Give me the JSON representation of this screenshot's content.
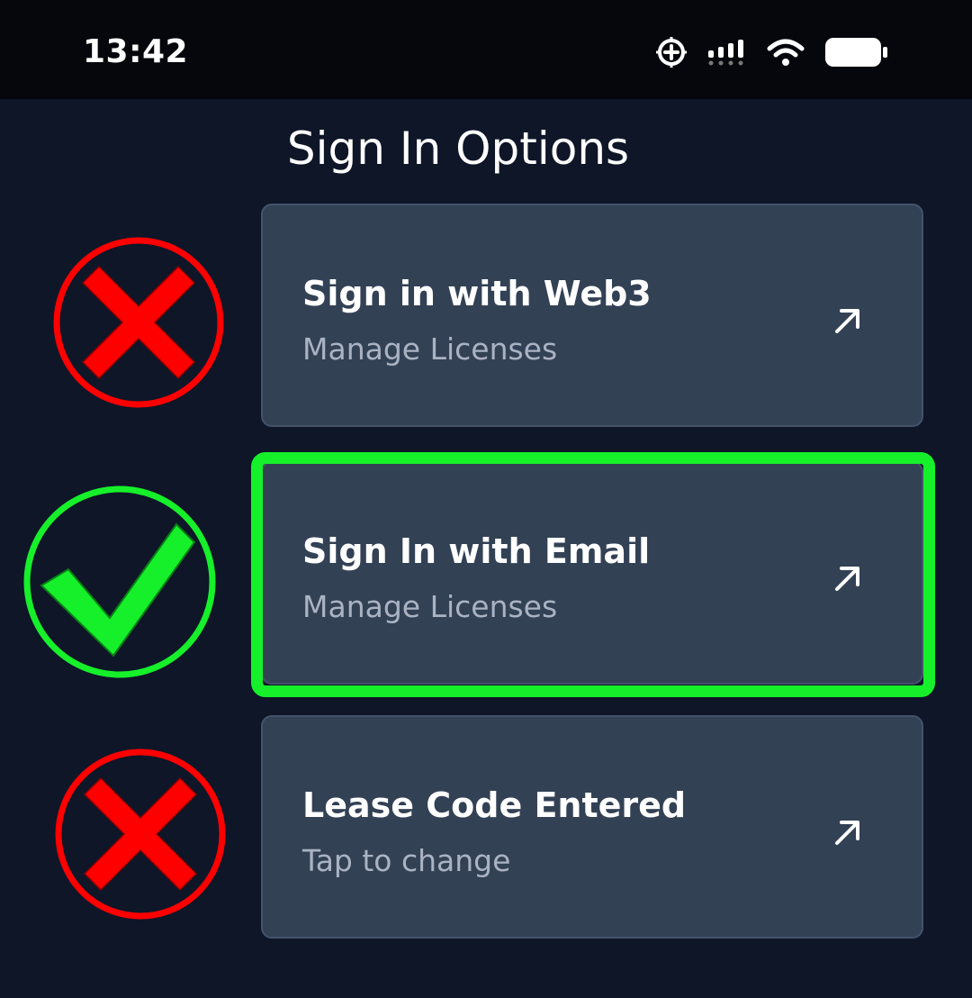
{
  "status_bar": {
    "time": "13:42",
    "icons": [
      "alarm-plus-icon",
      "signal-icon",
      "wifi-icon",
      "battery-icon"
    ]
  },
  "page": {
    "title": "Sign In Options"
  },
  "options": [
    {
      "title": "Sign in with Web3",
      "subtitle": "Manage Licenses",
      "mark": "red-x-icon",
      "highlighted": false
    },
    {
      "title": "Sign In with Email",
      "subtitle": "Manage Licenses",
      "mark": "green-check-icon",
      "highlighted": true
    },
    {
      "title": "Lease Code Entered",
      "subtitle": "Tap to change",
      "mark": "red-x-icon",
      "highlighted": false
    }
  ],
  "colors": {
    "background": "#0e1628",
    "status_bar": "#05070c",
    "card": "#334155",
    "subtitle_text": "#aab3c2",
    "highlight_green": "#16f02a",
    "red_mark": "#ff0000",
    "green_mark": "#16f02a"
  }
}
